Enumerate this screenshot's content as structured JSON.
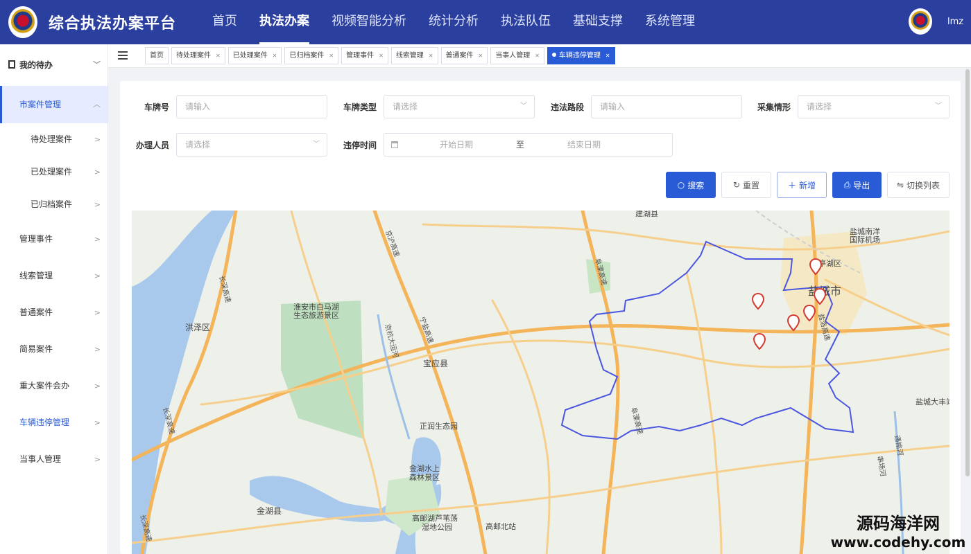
{
  "app": {
    "title": "综合执法办案平台",
    "username": "lmz"
  },
  "nav": [
    {
      "label": "首页"
    },
    {
      "label": "执法办案",
      "active": true
    },
    {
      "label": "视频智能分析"
    },
    {
      "label": "统计分析"
    },
    {
      "label": "执法队伍"
    },
    {
      "label": "基础支撑"
    },
    {
      "label": "系统管理"
    }
  ],
  "sidebar": {
    "group": "我的待办",
    "parent": "市案件管理",
    "children": [
      "待处理案件",
      "已处理案件",
      "已归档案件"
    ],
    "items": [
      "管理事件",
      "线索管理",
      "普通案件",
      "简易案件",
      "重大案件会办",
      "车辆违停管理",
      "当事人管理"
    ],
    "current": "车辆违停管理"
  },
  "tabs": [
    {
      "label": "首页",
      "closable": false
    },
    {
      "label": "待处理案件",
      "closable": true
    },
    {
      "label": "已处理案件",
      "closable": true
    },
    {
      "label": "已归档案件",
      "closable": true
    },
    {
      "label": "管理事件",
      "closable": true
    },
    {
      "label": "线索管理",
      "closable": true
    },
    {
      "label": "普通案件",
      "closable": true
    },
    {
      "label": "当事人管理",
      "closable": true
    },
    {
      "label": "车辆违停管理",
      "closable": true,
      "active": true
    }
  ],
  "form": {
    "plate": {
      "label": "车牌号",
      "placeholder": "请输入"
    },
    "plate_type": {
      "label": "车牌类型",
      "placeholder": "请选择"
    },
    "road": {
      "label": "违法路段",
      "placeholder": "请输入"
    },
    "capture": {
      "label": "采集情形",
      "placeholder": "请选择"
    },
    "handler": {
      "label": "办理人员",
      "placeholder": "请选择"
    },
    "time": {
      "label": "违停时间",
      "start": "开始日期",
      "sep": "至",
      "end": "结束日期"
    }
  },
  "buttons": {
    "search": "搜索",
    "reset": "重置",
    "add": "新增",
    "export": "导出",
    "toggle": "切换列表"
  },
  "map": {
    "places": [
      "建湖县",
      "亭湖区",
      "盐城市",
      "洪泽区",
      "淮安市白马湖",
      "生态旅游景区",
      "宝应县",
      "正润生态园",
      "金湖水上",
      "森林景区",
      "金湖县",
      "高邮湖芦苇荡",
      "湿地公园",
      "高邮北站",
      "盐城南洋",
      "国际机场",
      "盐城大丰站"
    ],
    "roads": [
      "长深高速",
      "京沪高速",
      "阜溧高速",
      "盐洛高速",
      "京杭大运河",
      "长深高速",
      "阜溧高速",
      "通榆河",
      "串场河",
      "宁盐高速",
      "长深高速"
    ],
    "markers": 6,
    "colors": {
      "region": "#4a56e0",
      "marker": "#d33a2f"
    }
  },
  "watermark": {
    "line1": "源码海洋网",
    "line2": "www.codehy.com"
  }
}
